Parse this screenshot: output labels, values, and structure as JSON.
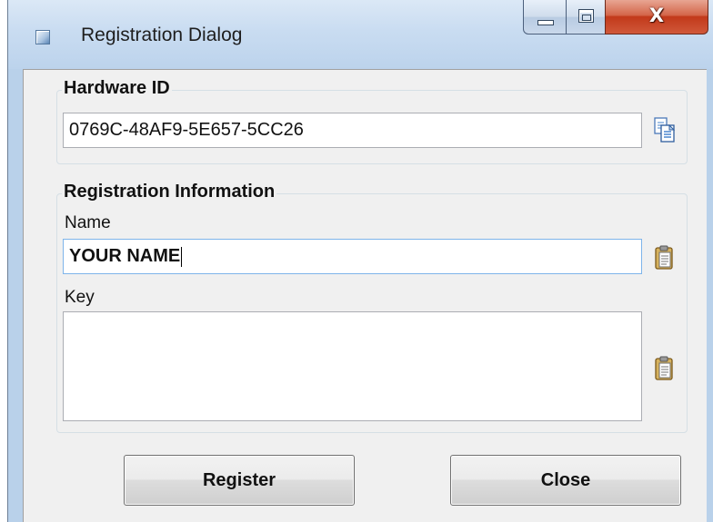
{
  "window": {
    "title": "Registration Dialog",
    "close_glyph": "X",
    "buttons": [
      "minimize-icon",
      "maximize-icon",
      "close-icon"
    ]
  },
  "hardware": {
    "group_title": "Hardware ID",
    "value": "0769C-48AF9-5E657-5CC26",
    "copy_icon": "copy-icon"
  },
  "registration": {
    "group_title": "Registration Information",
    "name_label": "Name",
    "name_value": "YOUR NAME",
    "key_label": "Key",
    "key_value": "",
    "paste_icon": "paste-icon"
  },
  "actions": {
    "register_label": "Register",
    "close_label": "Close"
  },
  "colors": {
    "window_frame": "#b9d1ea",
    "client_bg": "#f0f0f0",
    "close_button": "#c2391a",
    "focus_border": "#7eb4ea"
  }
}
